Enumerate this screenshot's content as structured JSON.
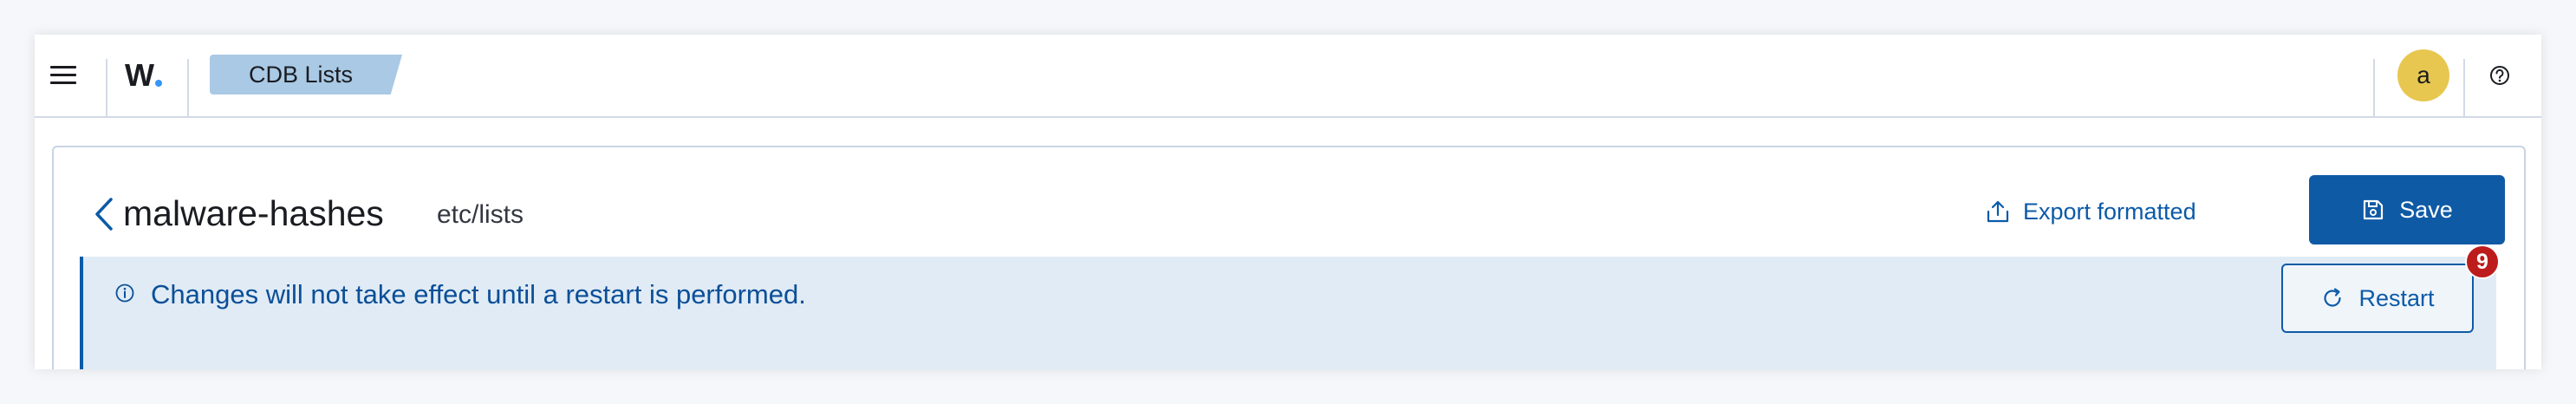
{
  "header": {
    "logo_text": "W",
    "breadcrumb_label": "CDB Lists",
    "avatar_initial": "a"
  },
  "page": {
    "title": "malware-hashes",
    "path": "etc/lists",
    "export_label": "Export formatted",
    "save_label": "Save"
  },
  "callout": {
    "message": "Changes will not take effect until a restart is performed.",
    "restart_label": "Restart",
    "badge_count": "9"
  },
  "colors": {
    "primary": "#0f5aa5",
    "breadcrumb_bg": "#a9c9e5",
    "callout_bg": "#e0ebf5",
    "avatar_bg": "#e7c74f",
    "badge": "#bd1c1c",
    "logo_dot": "#3595f9"
  },
  "icons": [
    "hamburger-icon",
    "help-icon",
    "chevron-left-icon",
    "export-icon",
    "save-icon",
    "info-icon",
    "refresh-icon"
  ]
}
